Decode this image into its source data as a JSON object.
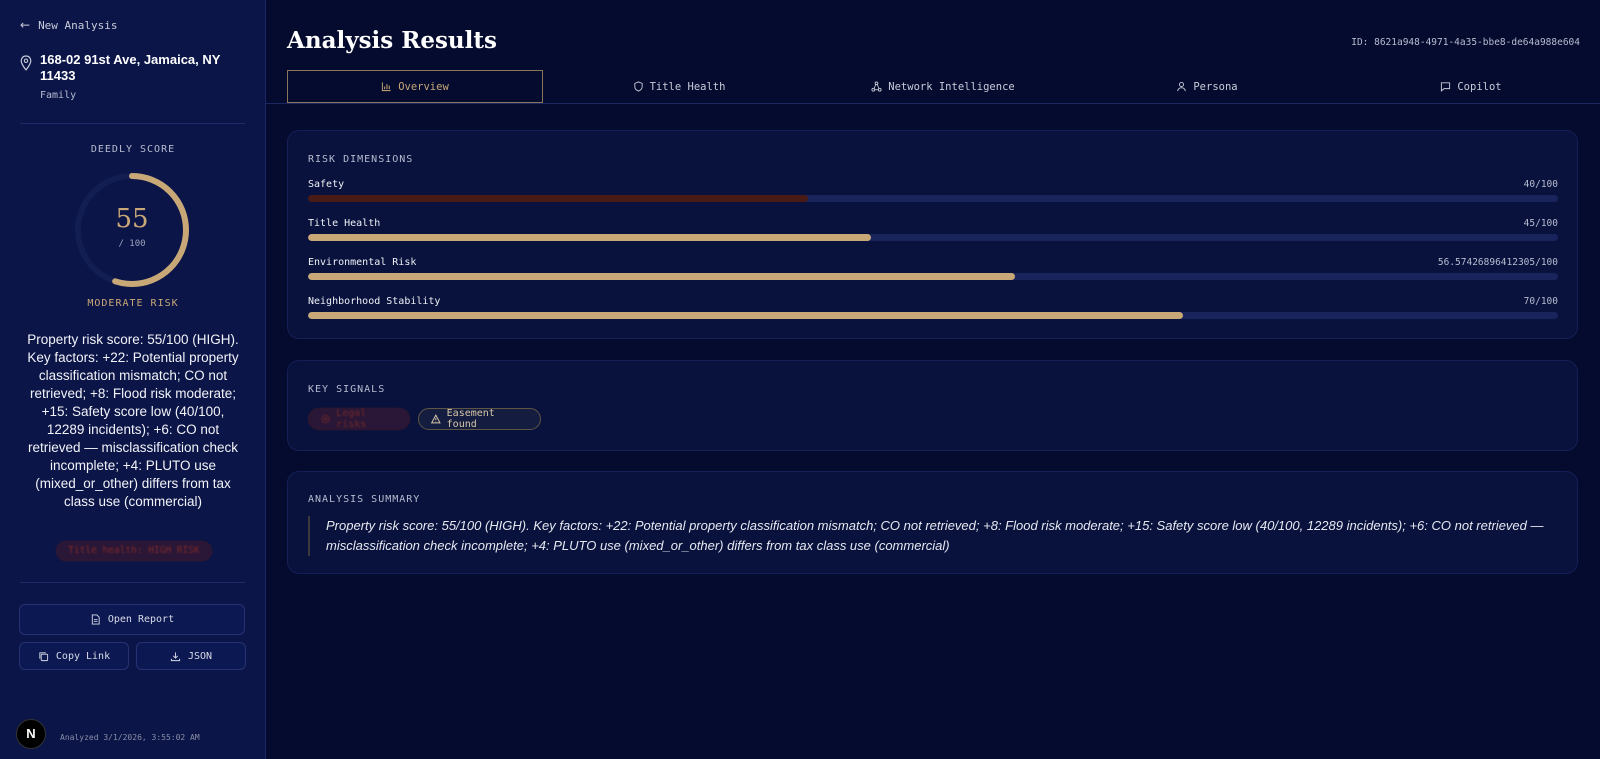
{
  "sidebar": {
    "back_label": "New Analysis",
    "address": "168-02 91st Ave, Jamaica, NY 11433",
    "persona": "Family",
    "score_title": "DEEDLY SCORE",
    "score": "55",
    "score_max": "/ 100",
    "score_fraction": 0.55,
    "risk_level": "MODERATE RISK",
    "summary": "Property risk score: 55/100 (HIGH). Key factors: +22: Potential property classification mismatch; CO not retrieved; +8: Flood risk moderate; +15: Safety score low (40/100, 12289 incidents); +6: CO not retrieved — misclassification check incomplete; +4: PLUTO use (mixed_or_other) differs from tax class use (commercial)",
    "title_badge": "Title health: HIGH RISK",
    "open_report": "Open Report",
    "copy_link": "Copy Link",
    "json": "JSON",
    "avatar_letter": "N",
    "analyzed": "Analyzed 3/1/2026, 3:55:02 AM"
  },
  "header": {
    "title": "Analysis Results",
    "id": "ID: 8621a948-4971-4a35-bbe8-de64a988e604"
  },
  "tabs": [
    {
      "label": "Overview",
      "icon": "bar-chart-icon",
      "active": true
    },
    {
      "label": "Title Health",
      "icon": "shield-icon",
      "active": false
    },
    {
      "label": "Network Intelligence",
      "icon": "network-icon",
      "active": false
    },
    {
      "label": "Persona",
      "icon": "user-icon",
      "active": false
    },
    {
      "label": "Copilot",
      "icon": "chat-icon",
      "active": false
    }
  ],
  "risk": {
    "title": "RISK DIMENSIONS",
    "dimensions": [
      {
        "label": "Safety",
        "value_text": "40/100",
        "value": 40,
        "status": "danger"
      },
      {
        "label": "Title Health",
        "value_text": "45/100",
        "value": 45,
        "status": "normal"
      },
      {
        "label": "Environmental Risk",
        "value_text": "56.57426896412305/100",
        "value": 56.57426896412305,
        "status": "normal"
      },
      {
        "label": "Neighborhood Stability",
        "value_text": "70/100",
        "value": 70,
        "status": "normal"
      }
    ]
  },
  "signals": {
    "title": "KEY SIGNALS",
    "items": [
      {
        "label": "Legal risks",
        "icon": "alert-circle-icon"
      },
      {
        "label": "Easement found",
        "icon": "warning-triangle-icon"
      }
    ]
  },
  "summary": {
    "title": "ANALYSIS SUMMARY",
    "text": "Property risk score: 55/100 (HIGH). Key factors: +22: Potential property classification mismatch; CO not retrieved; +8: Flood risk moderate; +15: Safety score low (40/100, 12289 incidents); +6: CO not retrieved — misclassification check incomplete; +4: PLUTO use (mixed_or_other) differs from tax class use (commercial)"
  },
  "colors": {
    "accent": "#c9a878",
    "background": "#050b2e",
    "sidebar": "#0b1547",
    "danger": "#4a1a16"
  }
}
